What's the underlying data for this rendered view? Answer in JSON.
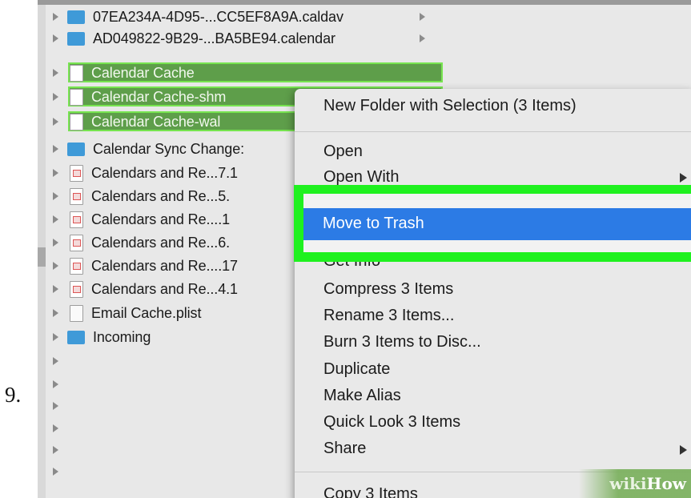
{
  "step_number": "9.",
  "files": [
    {
      "name": "07EA234A-4D95-...CC5EF8A9A.caldav",
      "kind": "folder",
      "has_arrow": true,
      "selected": false
    },
    {
      "name": "AD049822-9B29-...BA5BE94.calendar",
      "kind": "folder",
      "has_arrow": true,
      "selected": false
    },
    {
      "name": "Calendar Cache",
      "kind": "doc",
      "selected": true
    },
    {
      "name": "Calendar Cache-shm",
      "kind": "doc",
      "selected": true
    },
    {
      "name": "Calendar Cache-wal",
      "kind": "doc",
      "selected": true
    },
    {
      "name": "Calendar Sync Change:",
      "kind": "folder",
      "selected": false
    },
    {
      "name": "Calendars and Re...7.1",
      "kind": "cal",
      "selected": false
    },
    {
      "name": "Calendars and Re...5.",
      "kind": "cal",
      "selected": false
    },
    {
      "name": "Calendars and Re....1",
      "kind": "cal",
      "selected": false
    },
    {
      "name": "Calendars and Re...6.",
      "kind": "cal",
      "selected": false
    },
    {
      "name": "Calendars and Re....17",
      "kind": "cal",
      "selected": false
    },
    {
      "name": "Calendars and Re...4.1",
      "kind": "cal",
      "selected": false
    },
    {
      "name": "Email Cache.plist",
      "kind": "plist",
      "selected": false
    },
    {
      "name": "Incoming",
      "kind": "folder",
      "selected": false
    }
  ],
  "context_menu": {
    "header": "New Folder with Selection (3 Items)",
    "open": "Open",
    "open_with": "Open With",
    "move_to_trash": "Move to Trash",
    "get_info": "Get Info",
    "compress": "Compress 3 Items",
    "rename": "Rename 3 Items...",
    "burn": "Burn 3 Items to Disc...",
    "duplicate": "Duplicate",
    "make_alias": "Make Alias",
    "quick_look": "Quick Look 3 Items",
    "share": "Share",
    "copy": "Copy 3 Items"
  },
  "watermark": {
    "part1": "wiki",
    "part2": "How"
  },
  "colors": {
    "highlight_frame": "#1ff11f",
    "menu_selection": "#2c7be5",
    "selected_rows": "#5e9e4a",
    "folder": "#3f9ad8"
  }
}
